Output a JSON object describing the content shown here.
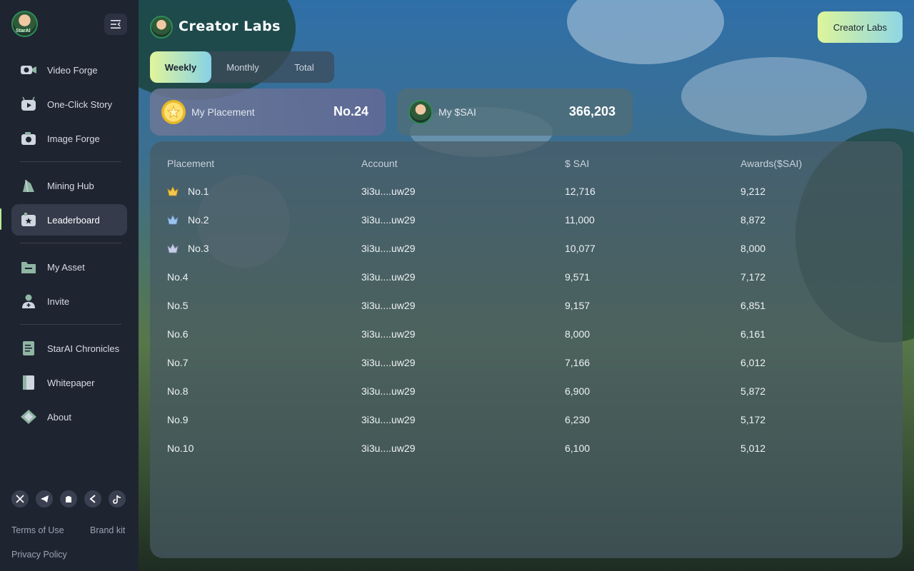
{
  "sidebar": {
    "avatar_tag": "StarAI",
    "nav_groups": [
      [
        {
          "label": "Video Forge",
          "icon": "video-camera-icon"
        },
        {
          "label": "One-Click Story",
          "icon": "play-robot-icon"
        },
        {
          "label": "Image Forge",
          "icon": "photo-camera-icon"
        }
      ],
      [
        {
          "label": "Mining Hub",
          "icon": "mining-crystal-icon"
        },
        {
          "label": "Leaderboard",
          "icon": "leaderboard-icon",
          "active": true
        }
      ],
      [
        {
          "label": "My Asset",
          "icon": "folder-icon"
        },
        {
          "label": "Invite",
          "icon": "invite-user-icon"
        }
      ],
      [
        {
          "label": "StarAI Chronicles",
          "icon": "book-icon"
        },
        {
          "label": "Whitepaper",
          "icon": "whitepaper-icon"
        },
        {
          "label": "About",
          "icon": "about-diamond-icon"
        }
      ]
    ],
    "social_icons": [
      "x-icon",
      "telegram-icon",
      "medium-icon",
      "back-chevron-icon",
      "tiktok-icon"
    ],
    "footer": {
      "terms": "Terms of Use",
      "brand_kit": "Brand kit",
      "privacy": "Privacy Policy"
    }
  },
  "header": {
    "title": "Creator Labs",
    "button": "Creator Labs"
  },
  "tabs": [
    {
      "label": "Weekly",
      "active": true
    },
    {
      "label": "Monthly"
    },
    {
      "label": "Total"
    }
  ],
  "placement_card": {
    "label": "My Placement",
    "value": "No.24"
  },
  "sai_card": {
    "label": "My $SAI",
    "value": "366,203"
  },
  "table": {
    "headers": [
      "Placement",
      "Account",
      "$ SAI",
      "Awards($SAI)"
    ],
    "rows": [
      {
        "placement": "No.1",
        "account": "3i3u....uw29",
        "sai": "12,716",
        "awards": "9,212",
        "medal": "gold"
      },
      {
        "placement": "No.2",
        "account": "3i3u....uw29",
        "sai": "11,000",
        "awards": "8,872",
        "medal": "silver"
      },
      {
        "placement": "No.3",
        "account": "3i3u....uw29",
        "sai": "10,077",
        "awards": "8,000",
        "medal": "bronze"
      },
      {
        "placement": "No.4",
        "account": "3i3u....uw29",
        "sai": "9,571",
        "awards": "7,172"
      },
      {
        "placement": "No.5",
        "account": "3i3u....uw29",
        "sai": "9,157",
        "awards": "6,851"
      },
      {
        "placement": "No.6",
        "account": "3i3u....uw29",
        "sai": "8,000",
        "awards": "6,161"
      },
      {
        "placement": "No.7",
        "account": "3i3u....uw29",
        "sai": "7,166",
        "awards": "6,012"
      },
      {
        "placement": "No.8",
        "account": "3i3u....uw29",
        "sai": "6,900",
        "awards": "5,872"
      },
      {
        "placement": "No.9",
        "account": "3i3u....uw29",
        "sai": "6,230",
        "awards": "5,172"
      },
      {
        "placement": "No.10",
        "account": "3i3u....uw29",
        "sai": "6,100",
        "awards": "5,012"
      }
    ]
  },
  "colors": {
    "accent_gradient_start": "#e1f59a",
    "accent_gradient_end": "#86d2e6",
    "sidebar_bg": "#1f2431",
    "active_nav_bg": "#353b4b"
  }
}
